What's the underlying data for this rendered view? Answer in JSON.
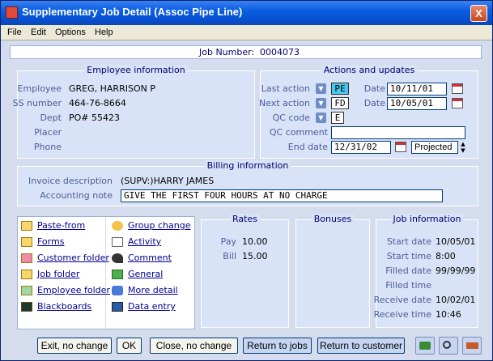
{
  "window": {
    "title": "Supplementary Job Detail (Assoc Pipe Line)",
    "close_label": "X"
  },
  "menu": [
    {
      "label": "File"
    },
    {
      "label": "Edit"
    },
    {
      "label": "Options"
    },
    {
      "label": "Help"
    }
  ],
  "job": {
    "label": "Job Number:",
    "value": "0004073"
  },
  "employee": {
    "title": "Employee information",
    "employee_label": "Employee",
    "employee_value": "GREG, HARRISON P",
    "ss_label": "SS number",
    "ss_value": "464-76-8664",
    "dept_label": "Dept",
    "dept_value": "PO# 55423",
    "placer_label": "Placer",
    "placer_value": "",
    "phone_label": "Phone",
    "phone_value": ""
  },
  "actions": {
    "title": "Actions and updates",
    "last_action_label": "Last action",
    "last_action_code": "PE",
    "next_action_label": "Next action",
    "next_action_code": "FD",
    "qc_code_label": "QC code",
    "qc_code_value": "E",
    "qc_comment_label": "QC comment",
    "qc_comment_value": "",
    "end_date_label": "End date",
    "end_date_value": "12/31/02",
    "end_status_value": "Projected",
    "date_label": "Date",
    "last_date_value": "10/11/01",
    "next_date_value": "10/05/01"
  },
  "billing": {
    "title": "Billing information",
    "invoice_label": "Invoice description",
    "invoice_value": "(SUPV:)HARRY JAMES",
    "accounting_label": "Accounting note",
    "accounting_value": "GIVE THE FIRST FOUR HOURS AT NO CHARGE"
  },
  "links_left": [
    {
      "label": "Paste-from",
      "icon": "folder-icon"
    },
    {
      "label": "Forms",
      "icon": "folder-icon"
    },
    {
      "label": "Customer folder",
      "icon": "folder-icon"
    },
    {
      "label": "Job folder",
      "icon": "folder-icon"
    },
    {
      "label": "Employee folder",
      "icon": "folder-icon"
    },
    {
      "label": "Blackboards",
      "icon": "blackboard-icon"
    }
  ],
  "links_right": [
    {
      "label": "Group change",
      "icon": "group-change-icon"
    },
    {
      "label": "Activity",
      "icon": "activity-icon"
    },
    {
      "label": "Comment",
      "icon": "comment-icon"
    },
    {
      "label": "General",
      "icon": "general-icon"
    },
    {
      "label": "More detail",
      "icon": "more-detail-icon"
    },
    {
      "label": "Data entry",
      "icon": "data-entry-icon"
    }
  ],
  "rates": {
    "title": "Rates",
    "pay_label": "Pay",
    "pay_value": "10.00",
    "bill_label": "Bill",
    "bill_value": "15.00"
  },
  "bonuses": {
    "title": "Bonuses"
  },
  "jobinfo": {
    "title": "Job information",
    "start_date_label": "Start date",
    "start_date_value": "10/05/01",
    "start_time_label": "Start time",
    "start_time_value": "8:00",
    "filled_date_label": "Filled date",
    "filled_date_value": "99/99/99",
    "filled_time_label": "Filled time",
    "filled_time_value": "",
    "receive_date_label": "Receive date",
    "receive_date_value": "10/02/01",
    "receive_time_label": "Receive time",
    "receive_time_value": "10:46"
  },
  "buttons": {
    "exit_no_change": "Exit, no change",
    "ok": "OK",
    "close_no_change": "Close, no change",
    "return_to_jobs": "Return to jobs",
    "return_to_customer": "Return to customer"
  },
  "colors": {
    "title_bar": "#0753d6",
    "panel_bg": "#d9e3f7",
    "link": "#00008b",
    "label": "#4a5d9a"
  }
}
